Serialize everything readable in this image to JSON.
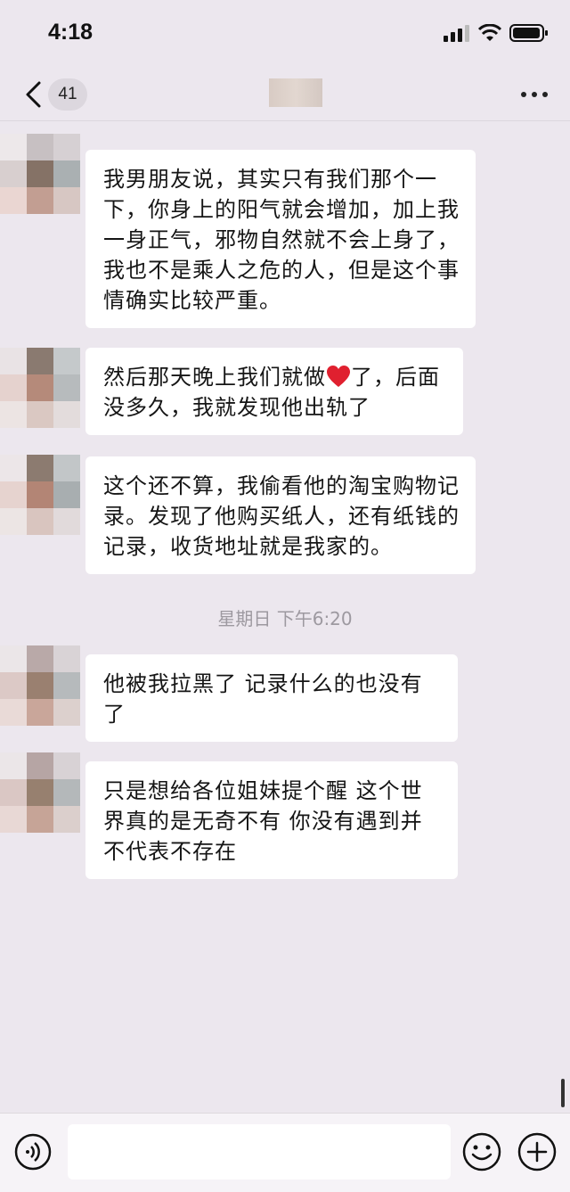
{
  "status_bar": {
    "time": "4:18"
  },
  "nav": {
    "unread_count": "41"
  },
  "messages": [
    {
      "text": "我男朋友说，其实只有我们那个一下，你身上的阳气就会增加，加上我一身正气，邪物自然就不会上身了，我也不是乘人之危的人，但是这个事情确实比较严重。"
    },
    {
      "text_before": "然后那天晚上我们就做",
      "emoji": "heart-icon",
      "text_after": "了，后面没多久，我就发现他出轨了"
    },
    {
      "text": "这个还不算，我偷看他的淘宝购物记录。发现了他购买纸人，还有纸钱的记录，收货地址就是我家的。"
    },
    {
      "text": "他被我拉黑了 记录什么的也没有了"
    },
    {
      "text": "只是想给各位姐妹提个醒 这个世界真的是无奇不有 你没有遇到并不代表不存在"
    }
  ],
  "timestamp": "星期日 下午6:20",
  "input": {
    "value": ""
  },
  "colors": {
    "background": "#ece7ee",
    "bubble": "#ffffff",
    "heart": "#e0202f"
  }
}
